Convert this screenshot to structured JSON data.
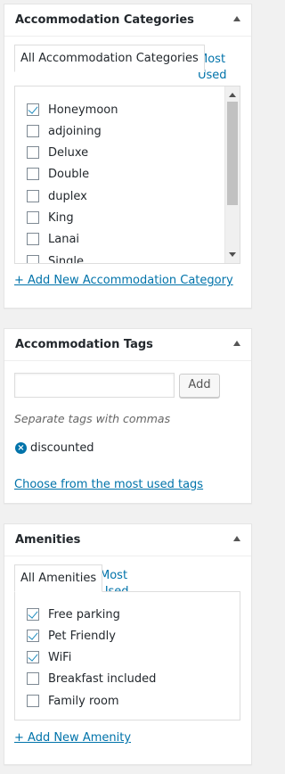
{
  "categories": {
    "title": "Accommodation Categories",
    "tab_all": "All Accommodation Categories",
    "tab_most_used": "Most Used",
    "items": [
      {
        "label": "Honeymoon",
        "checked": true
      },
      {
        "label": "adjoining",
        "checked": false
      },
      {
        "label": "Deluxe",
        "checked": false
      },
      {
        "label": "Double",
        "checked": false
      },
      {
        "label": "duplex",
        "checked": false
      },
      {
        "label": "King",
        "checked": false
      },
      {
        "label": "Lanai",
        "checked": false
      },
      {
        "label": "Single",
        "checked": false
      }
    ],
    "add_new": "+ Add New Accommodation Category"
  },
  "tags": {
    "title": "Accommodation Tags",
    "input_value": "",
    "add_button": "Add",
    "hint": "Separate tags with commas",
    "tag_remove_icon": "×",
    "tag": "discounted",
    "choose_link": "Choose from the most used tags"
  },
  "amenities": {
    "title": "Amenities",
    "tab_all": "All Amenities",
    "tab_most_used": "Most Used",
    "items": [
      {
        "label": "Free parking",
        "checked": true
      },
      {
        "label": "Pet Friendly",
        "checked": true
      },
      {
        "label": "WiFi",
        "checked": true
      },
      {
        "label": "Breakfast included",
        "checked": false
      },
      {
        "label": "Family room",
        "checked": false
      }
    ],
    "add_new": "+ Add New Amenity"
  },
  "colors": {
    "link": "#0073aa",
    "checkmark": "#1e8cbe"
  }
}
